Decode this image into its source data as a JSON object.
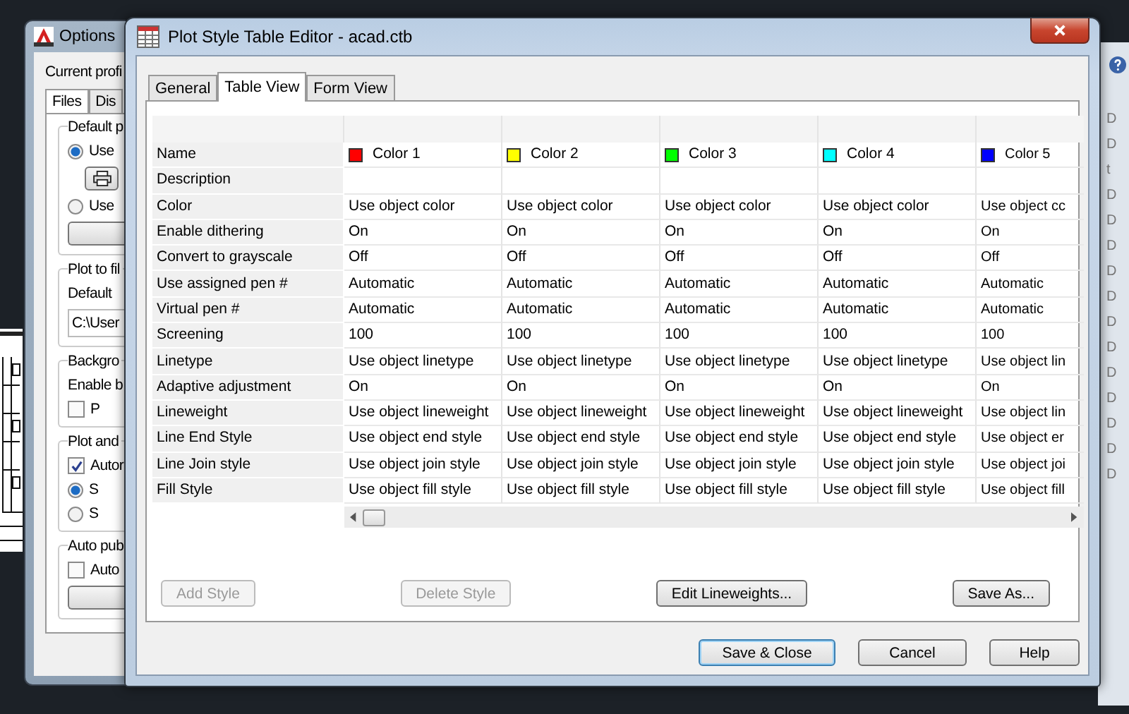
{
  "options_window": {
    "title": "Options",
    "profile_label": "Current profi",
    "tabs": [
      {
        "label": "Files",
        "selected": true
      },
      {
        "label": "Dis",
        "selected": false
      }
    ],
    "groups": [
      {
        "title": "Default p",
        "items": [
          {
            "kind": "radio",
            "label": "Use",
            "selected": true
          },
          {
            "kind": "icon_button"
          },
          {
            "kind": "radio",
            "label": "Use",
            "selected": false
          },
          {
            "kind": "button"
          }
        ]
      },
      {
        "title": "Plot to fil",
        "items": [
          {
            "kind": "label",
            "text": "Default"
          },
          {
            "kind": "field",
            "value": "C:\\User"
          }
        ]
      },
      {
        "title": "Backgro",
        "items": [
          {
            "kind": "label",
            "text": "Enable b"
          },
          {
            "kind": "checkbox",
            "label": "P",
            "checked": false
          }
        ]
      },
      {
        "title": "Plot and",
        "items": [
          {
            "kind": "checkbox",
            "label": "Autor",
            "checked": true
          },
          {
            "kind": "radio",
            "label": "S",
            "selected": true
          },
          {
            "kind": "radio",
            "label": "S",
            "selected": false
          }
        ]
      },
      {
        "title": "Auto pub",
        "items": [
          {
            "kind": "checkbox",
            "label": "Auto",
            "checked": false
          },
          {
            "kind": "button"
          }
        ]
      }
    ]
  },
  "dialog": {
    "title": "Plot Style Table Editor - acad.ctb",
    "tabs": [
      {
        "label": "General",
        "selected": false
      },
      {
        "label": "Table View",
        "selected": true
      },
      {
        "label": "Form View",
        "selected": false
      }
    ],
    "table": {
      "rows": [
        {
          "label": "Name",
          "kind": "name",
          "cells": [
            {
              "text": "Color 1",
              "color": "#ff0000"
            },
            {
              "text": "Color 2",
              "color": "#ffff00"
            },
            {
              "text": "Color 3",
              "color": "#00ff00"
            },
            {
              "text": "Color 4",
              "color": "#00ffff"
            },
            {
              "text": "Color 5",
              "color": "#0000ff"
            }
          ]
        },
        {
          "label": "Description",
          "kind": "text"
        },
        {
          "label": "Color",
          "kind": "text",
          "cells": [
            "Use object color",
            "Use object color",
            "Use object color",
            "Use object color",
            "Use object cc"
          ]
        },
        {
          "label": "Enable dithering",
          "kind": "text",
          "cells": [
            "On",
            "On",
            "On",
            "On",
            "On"
          ]
        },
        {
          "label": "Convert to grayscale",
          "kind": "text",
          "cells": [
            "Off",
            "Off",
            "Off",
            "Off",
            "Off"
          ]
        },
        {
          "label": "Use assigned pen #",
          "kind": "text",
          "cells": [
            "Automatic",
            "Automatic",
            "Automatic",
            "Automatic",
            "Automatic"
          ]
        },
        {
          "label": "Virtual pen #",
          "kind": "text",
          "cells": [
            "Automatic",
            "Automatic",
            "Automatic",
            "Automatic",
            "Automatic"
          ]
        },
        {
          "label": "Screening",
          "kind": "text",
          "cells": [
            "100",
            "100",
            "100",
            "100",
            "100"
          ]
        },
        {
          "label": "Linetype",
          "kind": "text",
          "cells": [
            "Use object linetype",
            "Use object linetype",
            "Use object linetype",
            "Use object linetype",
            "Use object lin"
          ]
        },
        {
          "label": "Adaptive adjustment",
          "kind": "text",
          "cells": [
            "On",
            "On",
            "On",
            "On",
            "On"
          ]
        },
        {
          "label": "Lineweight",
          "kind": "text",
          "cells": [
            "Use object lineweight",
            "Use object lineweight",
            "Use object lineweight",
            "Use object lineweight",
            "Use object lin"
          ]
        },
        {
          "label": "Line End Style",
          "kind": "text",
          "cells": [
            "Use object end style",
            "Use object end style",
            "Use object end style",
            "Use object end style",
            "Use object er"
          ]
        },
        {
          "label": "Line Join style",
          "kind": "text",
          "cells": [
            "Use object join style",
            "Use object join style",
            "Use object join style",
            "Use object join style",
            "Use object joi"
          ]
        },
        {
          "label": "Fill Style",
          "kind": "text",
          "cells": [
            "Use object fill style",
            "Use object fill style",
            "Use object fill style",
            "Use object fill style",
            "Use object fill"
          ]
        }
      ]
    },
    "table_buttons": [
      {
        "label": "Add Style",
        "disabled": true
      },
      {
        "label": "Delete Style",
        "disabled": true
      },
      {
        "label": "Edit Lineweights...",
        "disabled": false
      },
      {
        "label": "Save As...",
        "disabled": false
      }
    ],
    "dialog_buttons": [
      {
        "label": "Save & Close",
        "default": true
      },
      {
        "label": "Cancel",
        "default": false
      },
      {
        "label": "Help",
        "default": false
      }
    ]
  },
  "side_window": {
    "entries": [
      "D",
      "D",
      "t",
      "D",
      "D",
      "D",
      "D",
      "D",
      "D",
      "D",
      "D",
      "D",
      "D",
      "D",
      "D"
    ]
  }
}
